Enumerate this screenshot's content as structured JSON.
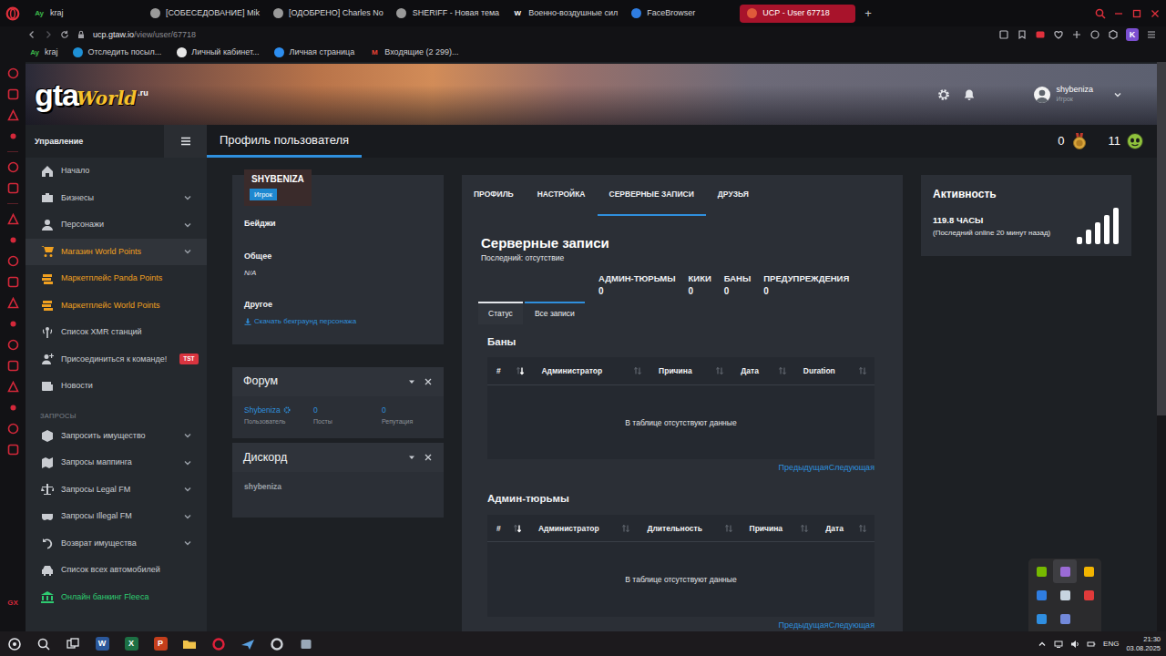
{
  "browser": {
    "tabs": [
      {
        "label": "kraj",
        "favicon": "Ay",
        "kind": "letters",
        "color": "#3bb54a",
        "selected": false
      },
      {
        "label": "[СОБЕСЕДОВАНИЕ] Mik",
        "kind": "dot",
        "color": "#9a9a9a",
        "selected": false
      },
      {
        "label": "[ОДОБРЕНО] Charles No",
        "kind": "dot",
        "color": "#9a9a9a",
        "selected": false
      },
      {
        "label": "SHERIFF - Новая тема",
        "kind": "dot",
        "color": "#9a9a9a",
        "selected": false
      },
      {
        "label": "Военно-воздушные сил",
        "favicon": "W",
        "kind": "letters",
        "color": "#ffffff",
        "selected": false
      },
      {
        "label": "FaceBrowser",
        "kind": "dot",
        "color": "#2f7de1",
        "selected": false
      },
      {
        "label": "UCP - User 67718",
        "kind": "dot",
        "color": "#e05a3a",
        "selected": true
      }
    ],
    "new_tab": "+",
    "address": {
      "host": "ucp.gtaw.io",
      "path": "/view/user/67718"
    },
    "profile_letter": "K",
    "bookmarks": [
      {
        "label": "kraj",
        "favicon": "Ay",
        "kind": "letters",
        "color": "#3bb54a"
      },
      {
        "label": "Отследить посыл...",
        "kind": "dot",
        "color": "#1e90d6"
      },
      {
        "label": "Личный кабинет...",
        "kind": "dot",
        "color": "#e6e6e6"
      },
      {
        "label": "Личная страница",
        "kind": "dot",
        "color": "#2d8ef0"
      },
      {
        "label": "Входящие (2 299)...",
        "favicon": "M",
        "kind": "letters",
        "color": "#ea4335"
      }
    ],
    "sidebar_badge": "GX",
    "page_scroll": {
      "level": 0.62
    }
  },
  "site": {
    "logo": {
      "main": "gta",
      "script": "World",
      "tld": ".ru"
    },
    "user": {
      "name": "shybeniza",
      "role": "Игрок"
    },
    "sidebar_title": "Управление",
    "page_title": "Профиль пользователя",
    "counters": [
      {
        "value": "0",
        "kind": "medal"
      },
      {
        "value": "11",
        "kind": "face"
      }
    ]
  },
  "nav": [
    {
      "label": "Начало",
      "kind": "link",
      "submenu": false,
      "selected": false,
      "color": "#c9ccd1"
    },
    {
      "label": "Бизнесы",
      "kind": "link",
      "submenu": true,
      "selected": false,
      "color": "#c9ccd1"
    },
    {
      "label": "Персонажи",
      "kind": "link",
      "submenu": true,
      "selected": false,
      "color": "#c9ccd1"
    },
    {
      "label": "Магазин World Points",
      "kind": "link",
      "submenu": true,
      "selected": true,
      "color": "#f0a020"
    },
    {
      "label": "Маркетплейс Panda Points",
      "kind": "link",
      "submenu": false,
      "selected": false,
      "color": "#f0a020"
    },
    {
      "label": "Маркетплейс World Points",
      "kind": "link",
      "submenu": false,
      "selected": false,
      "color": "#f0a020"
    },
    {
      "label": "Список XMR станций",
      "kind": "link",
      "submenu": false,
      "selected": false,
      "color": "#c9ccd1"
    },
    {
      "label": "Присоединиться к команде!",
      "kind": "link",
      "submenu": false,
      "selected": false,
      "color": "#c9ccd1",
      "badge": "TST"
    },
    {
      "label": "Новости",
      "kind": "link",
      "submenu": false,
      "selected": false,
      "color": "#c9ccd1"
    },
    {
      "label": "ЗАПРОСЫ",
      "kind": "heading",
      "submenu": false,
      "selected": false,
      "color": "#7d838c"
    },
    {
      "label": "Запросить имущество",
      "kind": "link",
      "submenu": true,
      "selected": false,
      "color": "#c9ccd1"
    },
    {
      "label": "Запросы маппинга",
      "kind": "link",
      "submenu": true,
      "selected": false,
      "color": "#c9ccd1"
    },
    {
      "label": "Запросы Legal FM",
      "kind": "link",
      "submenu": true,
      "selected": false,
      "color": "#c9ccd1"
    },
    {
      "label": "Запросы Illegal FM",
      "kind": "link",
      "submenu": true,
      "selected": false,
      "color": "#c9ccd1"
    },
    {
      "label": "Возврат имущества",
      "kind": "link",
      "submenu": true,
      "selected": false,
      "color": "#c9ccd1"
    },
    {
      "label": "Список всех автомобилей",
      "kind": "link",
      "submenu": false,
      "selected": false,
      "color": "#c9ccd1"
    },
    {
      "label": "Онлайн банкинг Fleeca",
      "kind": "link",
      "submenu": false,
      "selected": false,
      "color": "#2ecc71"
    }
  ],
  "profile": {
    "name": "SHYBENIZA",
    "role": "Игрок",
    "sections": [
      {
        "title": "Бейджи"
      },
      {
        "title": "Общее",
        "value": "N/A"
      },
      {
        "title": "Другое",
        "link": "Скачать бекграунд персонажа"
      }
    ]
  },
  "forum": {
    "title": "Форум",
    "user": "Shybeniza",
    "user_caption": "Пользователь",
    "stats": [
      {
        "value": "0",
        "label": "Посты"
      },
      {
        "value": "0",
        "label": "Репутация"
      }
    ]
  },
  "discord": {
    "title": "Дискорд",
    "user": "shybeniza"
  },
  "main_tabs": [
    {
      "label": "ПРОФИЛЬ",
      "selected": false
    },
    {
      "label": "НАСТРОЙКА",
      "selected": false
    },
    {
      "label": "СЕРВЕРНЫЕ ЗАПИСИ",
      "selected": true
    },
    {
      "label": "ДРУЗЬЯ",
      "selected": false
    }
  ],
  "records": {
    "title": "Серверные записи",
    "last": "Последний: отсутствие",
    "stats": [
      {
        "label": "АДМИН-ТЮРЬМЫ",
        "value": "0"
      },
      {
        "label": "КИКИ",
        "value": "0"
      },
      {
        "label": "БАНЫ",
        "value": "0"
      },
      {
        "label": "ПРЕДУПРЕЖДЕНИЯ",
        "value": "0"
      }
    ],
    "subtabs": [
      {
        "label": "Статус",
        "selected": true
      },
      {
        "label": "Все записи",
        "selected": false
      }
    ],
    "tables": [
      {
        "title": "Баны",
        "columns": [
          {
            "label": "#",
            "sorted": true
          },
          {
            "label": "Администратор",
            "sorted": false
          },
          {
            "label": "Причина",
            "sorted": false
          },
          {
            "label": "Дата",
            "sorted": false
          },
          {
            "label": "Duration",
            "sorted": false
          }
        ],
        "empty": "В таблице отсутствуют данные",
        "prev": "Предыдущая",
        "next": "Следующая"
      },
      {
        "title": "Админ-тюрьмы",
        "columns": [
          {
            "label": "#",
            "sorted": true
          },
          {
            "label": "Администратор",
            "sorted": false
          },
          {
            "label": "Длительность",
            "sorted": false
          },
          {
            "label": "Причина",
            "sorted": false
          },
          {
            "label": "Дата",
            "sorted": false
          }
        ],
        "empty": "В таблице отсутствуют данные",
        "prev": "Предыдущая",
        "next": "Следующая"
      }
    ]
  },
  "activity": {
    "title": "Активность",
    "hours": "119.8 ЧАСЫ",
    "last_online": "(Последний online 20 минут назад)"
  },
  "taskbar": {
    "apps": [
      {
        "kind": "letter",
        "glyph": "W",
        "color": "#2b579a"
      },
      {
        "kind": "letter",
        "glyph": "X",
        "color": "#1d7044"
      },
      {
        "kind": "letter",
        "glyph": "P",
        "color": "#c43e1c"
      },
      {
        "kind": "folder",
        "color": "#f0c24a"
      },
      {
        "kind": "ring",
        "color": "#e0203a"
      },
      {
        "kind": "plane",
        "color": "#5aa0e0"
      },
      {
        "kind": "ring",
        "color": "#cfd3d8"
      },
      {
        "kind": "box",
        "color": "#9aa8b8"
      }
    ],
    "lang": "ENG",
    "time": "21:30",
    "date": "03.08.2025"
  },
  "tray_overflow": [
    {
      "color": "#76b900",
      "selected": false
    },
    {
      "color": "#9b6bd6",
      "selected": true
    },
    {
      "color": "#f2b400",
      "selected": false
    },
    {
      "color": "#2f7de1",
      "selected": false
    },
    {
      "color": "#c7d5e0",
      "selected": false
    },
    {
      "color": "#e03a3a",
      "selected": false
    },
    {
      "color": "#2f8ee0",
      "selected": false
    },
    {
      "color": "#7289da",
      "selected": false
    }
  ]
}
